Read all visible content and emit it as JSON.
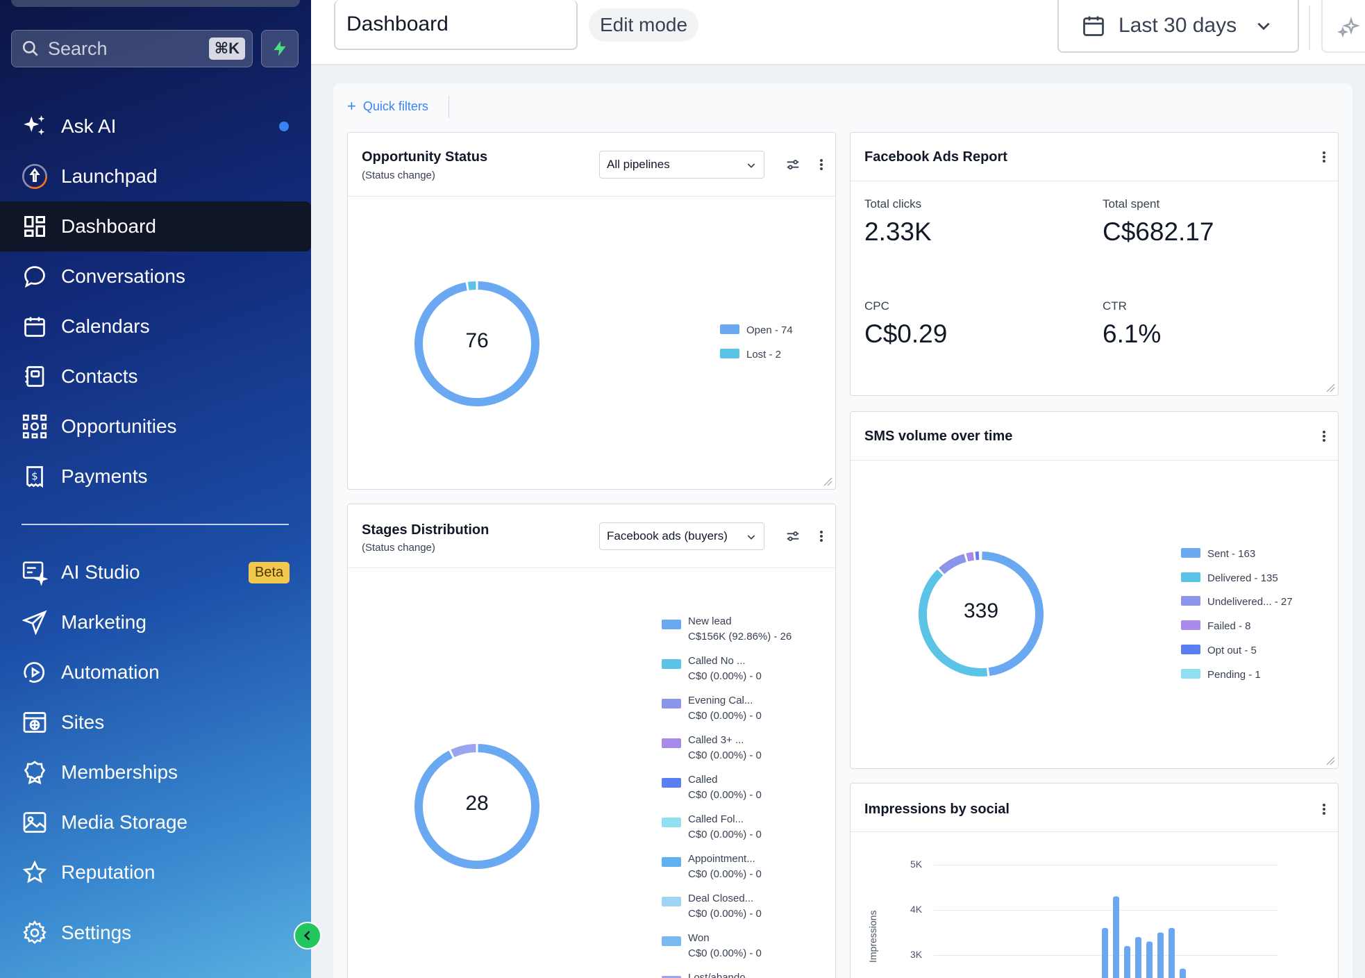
{
  "sidebar": {
    "search_placeholder": "Search",
    "search_shortcut": "⌘K",
    "items": [
      {
        "label": "Ask AI",
        "icon": "sparkles-icon"
      },
      {
        "label": "Launchpad",
        "icon": "rocket-icon"
      },
      {
        "label": "Dashboard",
        "icon": "dashboard-grid-icon",
        "active": true
      },
      {
        "label": "Conversations",
        "icon": "chat-bubble-icon"
      },
      {
        "label": "Calendars",
        "icon": "calendar-icon"
      },
      {
        "label": "Contacts",
        "icon": "contacts-book-icon"
      },
      {
        "label": "Opportunities",
        "icon": "opportunities-network-icon"
      },
      {
        "label": "Payments",
        "icon": "receipt-dollar-icon"
      }
    ],
    "items2": [
      {
        "label": "AI Studio",
        "icon": "ai-studio-icon",
        "badge": "Beta"
      },
      {
        "label": "Marketing",
        "icon": "paper-plane-icon"
      },
      {
        "label": "Automation",
        "icon": "play-circle-icon"
      },
      {
        "label": "Sites",
        "icon": "globe-window-icon"
      },
      {
        "label": "Memberships",
        "icon": "award-badge-icon"
      },
      {
        "label": "Media Storage",
        "icon": "image-icon"
      },
      {
        "label": "Reputation",
        "icon": "star-icon"
      },
      {
        "label": "Settings",
        "icon": "gear-icon"
      }
    ]
  },
  "header": {
    "dashboard_name": "Dashboard",
    "edit_mode_label": "Edit mode",
    "date_range_label": "Last 30 days"
  },
  "quick_filters_label": "Quick filters",
  "opportunity_status": {
    "title": "Opportunity Status",
    "subtitle": "(Status change)",
    "pipeline_select": "All pipelines",
    "total": "76",
    "legend": [
      {
        "label": "Open - 74",
        "value": 74,
        "color": "#6aa8f2"
      },
      {
        "label": "Lost - 2",
        "value": 2,
        "color": "#5bc4e6"
      }
    ]
  },
  "facebook_ads": {
    "title": "Facebook Ads Report",
    "metrics": [
      {
        "label": "Total clicks",
        "value": "2.33K"
      },
      {
        "label": "Total spent",
        "value": "C$682.17"
      },
      {
        "label": "CPC",
        "value": "C$0.29"
      },
      {
        "label": "CTR",
        "value": "6.1%"
      }
    ]
  },
  "sms_volume": {
    "title": "SMS volume over time",
    "total": "339",
    "legend": [
      {
        "label": "Sent - 163",
        "value": 163,
        "color": "#6aa8f2"
      },
      {
        "label": "Delivered - 135",
        "value": 135,
        "color": "#5bc4e6"
      },
      {
        "label": "Undelivered... - 27",
        "value": 27,
        "color": "#8b96ea"
      },
      {
        "label": "Failed - 8",
        "value": 8,
        "color": "#a98ae8"
      },
      {
        "label": "Opt out - 5",
        "value": 5,
        "color": "#5b7ff0"
      },
      {
        "label": "Pending - 1",
        "value": 1,
        "color": "#8fe0f2"
      }
    ]
  },
  "stages_distribution": {
    "title": "Stages Distribution",
    "subtitle": "(Status change)",
    "pipeline_select": "Facebook ads (buyers)",
    "total": "28",
    "legend": [
      {
        "line1": "New lead",
        "line2": "C$156K (92.86%) - 26",
        "value": 26,
        "color": "#6aa8f2"
      },
      {
        "line1": "Called  No ...",
        "line2": "C$0 (0.00%) - 0",
        "value": 0,
        "color": "#5bc4e6"
      },
      {
        "line1": "Evening Cal...",
        "line2": "C$0 (0.00%) - 0",
        "value": 0,
        "color": "#8b96ea"
      },
      {
        "line1": "Called  3+ ...",
        "line2": "C$0 (0.00%) - 0",
        "value": 0,
        "color": "#a98ae8"
      },
      {
        "line1": "Called",
        "line2": "C$0 (0.00%) - 0",
        "value": 0,
        "color": "#5b7ff0"
      },
      {
        "line1": "Called  Fol...",
        "line2": "C$0 (0.00%) - 0",
        "value": 0,
        "color": "#8fe0f2"
      },
      {
        "line1": "Appointment...",
        "line2": "C$0 (0.00%) - 0",
        "value": 0,
        "color": "#5fb0ee"
      },
      {
        "line1": "Deal Closed...",
        "line2": "C$0 (0.00%) - 0",
        "value": 0,
        "color": "#9fd4f5"
      },
      {
        "line1": "Won",
        "line2": "C$0 (0.00%) - 0",
        "value": 0,
        "color": "#7cb8f0"
      },
      {
        "line1": "Lost/abando...",
        "line2": "",
        "value": 2,
        "color": "#9aa4ef"
      }
    ]
  },
  "impressions": {
    "title": "Impressions by social",
    "y_axis_label": "Impressions",
    "y_ticks": [
      "5K",
      "4K",
      "3K"
    ]
  },
  "chart_data": {
    "type": "bar",
    "ylim_visible": [
      2500,
      5000
    ],
    "values": [
      3600,
      4300,
      3200,
      3400,
      3300,
      3500,
      3600,
      2700
    ],
    "color": "#6aa8f2"
  }
}
